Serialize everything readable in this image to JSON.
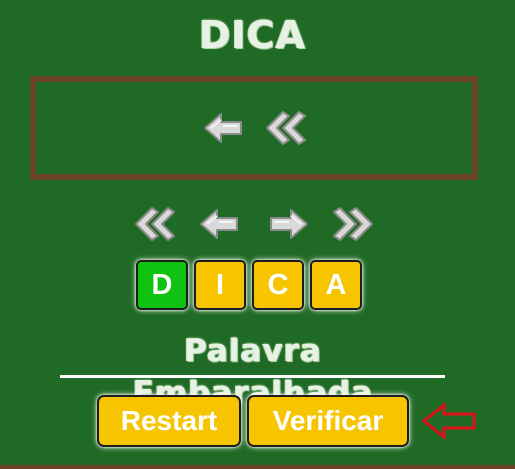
{
  "title": "DICA",
  "hint": {
    "arrows": [
      {
        "icon": "arrow-left-icon"
      },
      {
        "icon": "double-chevron-left-icon"
      }
    ]
  },
  "controls": [
    {
      "icon": "double-chevron-left-icon"
    },
    {
      "icon": "arrow-left-icon"
    },
    {
      "icon": "arrow-right-icon"
    },
    {
      "icon": "double-chevron-right-icon"
    }
  ],
  "tiles": [
    {
      "letter": "D",
      "state": "active",
      "color": "#11c311"
    },
    {
      "letter": "I",
      "state": "normal",
      "color": "#f7c400"
    },
    {
      "letter": "C",
      "state": "normal",
      "color": "#f7c400"
    },
    {
      "letter": "A",
      "state": "normal",
      "color": "#f7c400"
    }
  ],
  "subtitle": "Palavra Embaralhada",
  "buttons": {
    "restart_label": "Restart",
    "verify_label": "Verificar"
  },
  "pointer_icon": "red-arrow-left-icon",
  "colors": {
    "board": "#1f6a24",
    "frame": "#6b4426",
    "tile": "#f7c400",
    "tile_active": "#11c311",
    "pointer": "#e0101a"
  }
}
